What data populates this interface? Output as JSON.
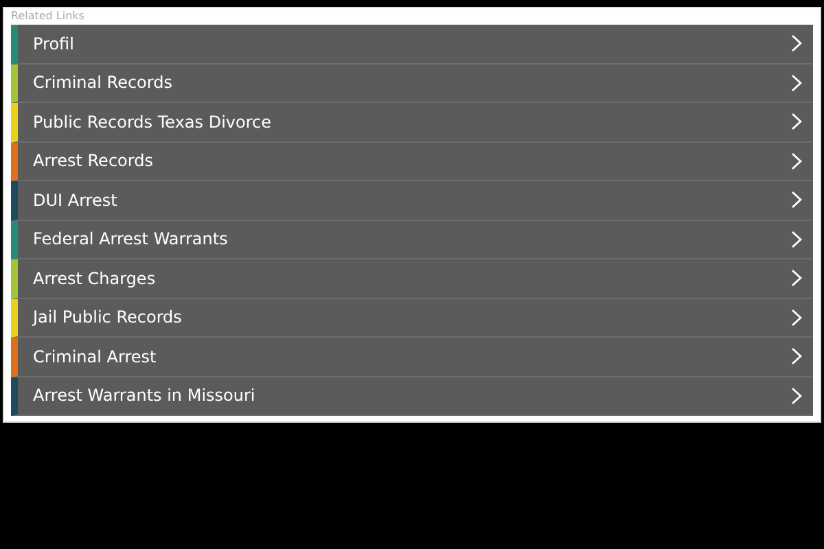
{
  "panel": {
    "title": "Related Links"
  },
  "links": [
    {
      "label": "Profil",
      "color": "#2a8a78"
    },
    {
      "label": "Criminal Records",
      "color": "#a6c43a"
    },
    {
      "label": "Public Records Texas Divorce",
      "color": "#e8d21a"
    },
    {
      "label": "Arrest Records",
      "color": "#e0701e"
    },
    {
      "label": "DUI Arrest",
      "color": "#1d4a5e"
    },
    {
      "label": "Federal Arrest Warrants",
      "color": "#2a8a78"
    },
    {
      "label": "Arrest Charges",
      "color": "#a6c43a"
    },
    {
      "label": "Jail Public Records",
      "color": "#e8d21a"
    },
    {
      "label": "Criminal Arrest",
      "color": "#e0701e"
    },
    {
      "label": "Arrest Warrants in Missouri",
      "color": "#1d4a5e"
    }
  ]
}
